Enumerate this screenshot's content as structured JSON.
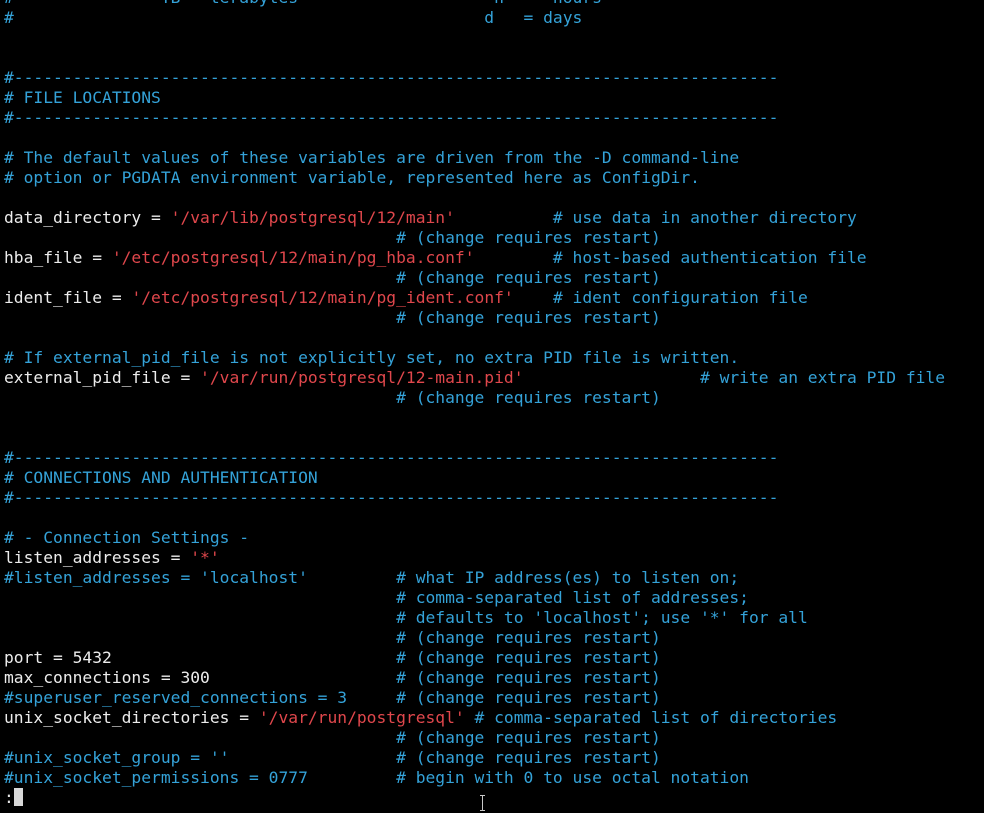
{
  "terminal": {
    "lines": [
      [
        {
          "t": "#",
          "c": "comment"
        },
        {
          "t": "               TB = terabytes                    h   = hours",
          "c": "comment"
        }
      ],
      [
        {
          "t": "#                                                d   = days",
          "c": "comment"
        }
      ],
      [],
      [],
      [
        {
          "t": "#------------------------------------------------------------------------------",
          "c": "comment"
        }
      ],
      [
        {
          "t": "# FILE LOCATIONS",
          "c": "comment"
        }
      ],
      [
        {
          "t": "#------------------------------------------------------------------------------",
          "c": "comment"
        }
      ],
      [],
      [
        {
          "t": "# The default values of these variables are driven from the -D command-line",
          "c": "comment"
        }
      ],
      [
        {
          "t": "# option or PGDATA environment variable, represented here as ConfigDir.",
          "c": "comment"
        }
      ],
      [],
      [
        {
          "t": "data_directory = ",
          "c": "plain"
        },
        {
          "t": "'/var/lib/postgresql/12/main'",
          "c": "string"
        },
        {
          "t": "          # use data in another directory",
          "c": "comment"
        }
      ],
      [
        {
          "t": "                                        # (change requires restart)",
          "c": "comment"
        }
      ],
      [
        {
          "t": "hba_file = ",
          "c": "plain"
        },
        {
          "t": "'/etc/postgresql/12/main/pg_hba.conf'",
          "c": "string"
        },
        {
          "t": "        # host-based authentication file",
          "c": "comment"
        }
      ],
      [
        {
          "t": "                                        # (change requires restart)",
          "c": "comment"
        }
      ],
      [
        {
          "t": "ident_file = ",
          "c": "plain"
        },
        {
          "t": "'/etc/postgresql/12/main/pg_ident.conf'",
          "c": "string"
        },
        {
          "t": "    # ident configuration file",
          "c": "comment"
        }
      ],
      [
        {
          "t": "                                        # (change requires restart)",
          "c": "comment"
        }
      ],
      [],
      [
        {
          "t": "# If external_pid_file is not explicitly set, no extra PID file is written.",
          "c": "comment"
        }
      ],
      [
        {
          "t": "external_pid_file = ",
          "c": "plain"
        },
        {
          "t": "'/var/run/postgresql/12-main.pid'",
          "c": "string"
        },
        {
          "t": "                  # write an extra PID file",
          "c": "comment"
        }
      ],
      [
        {
          "t": "                                        # (change requires restart)",
          "c": "comment"
        }
      ],
      [],
      [],
      [
        {
          "t": "#------------------------------------------------------------------------------",
          "c": "comment"
        }
      ],
      [
        {
          "t": "# CONNECTIONS AND AUTHENTICATION",
          "c": "comment"
        }
      ],
      [
        {
          "t": "#------------------------------------------------------------------------------",
          "c": "comment"
        }
      ],
      [],
      [
        {
          "t": "# - Connection Settings -",
          "c": "comment"
        }
      ],
      [
        {
          "t": "listen_addresses = ",
          "c": "plain"
        },
        {
          "t": "'*'",
          "c": "string"
        }
      ],
      [
        {
          "t": "#listen_addresses = 'localhost'         # what IP address(es) to listen on;",
          "c": "comment"
        }
      ],
      [
        {
          "t": "                                        # comma-separated list of addresses;",
          "c": "comment"
        }
      ],
      [
        {
          "t": "                                        # defaults to 'localhost'; use '*' for all",
          "c": "comment"
        }
      ],
      [
        {
          "t": "                                        # (change requires restart)",
          "c": "comment"
        }
      ],
      [
        {
          "t": "port = 5432                             ",
          "c": "plain"
        },
        {
          "t": "# (change requires restart)",
          "c": "comment"
        }
      ],
      [
        {
          "t": "max_connections = 300                   ",
          "c": "plain"
        },
        {
          "t": "# (change requires restart)",
          "c": "comment"
        }
      ],
      [
        {
          "t": "#superuser_reserved_connections = 3     # (change requires restart)",
          "c": "comment"
        }
      ],
      [
        {
          "t": "unix_socket_directories = ",
          "c": "plain"
        },
        {
          "t": "'/var/run/postgresql'",
          "c": "string"
        },
        {
          "t": " # comma-separated list of directories",
          "c": "comment"
        }
      ],
      [
        {
          "t": "                                        # (change requires restart)",
          "c": "comment"
        }
      ],
      [
        {
          "t": "#unix_socket_group = ''                 # (change requires restart)",
          "c": "comment"
        }
      ],
      [
        {
          "t": "#unix_socket_permissions = 0777         # begin with 0 to use octal notation",
          "c": "comment"
        }
      ]
    ],
    "prompt": ":"
  },
  "colors": {
    "background": "#000000",
    "plain": "#ececec",
    "comment": "#34a2d8",
    "string": "#e0474c"
  }
}
